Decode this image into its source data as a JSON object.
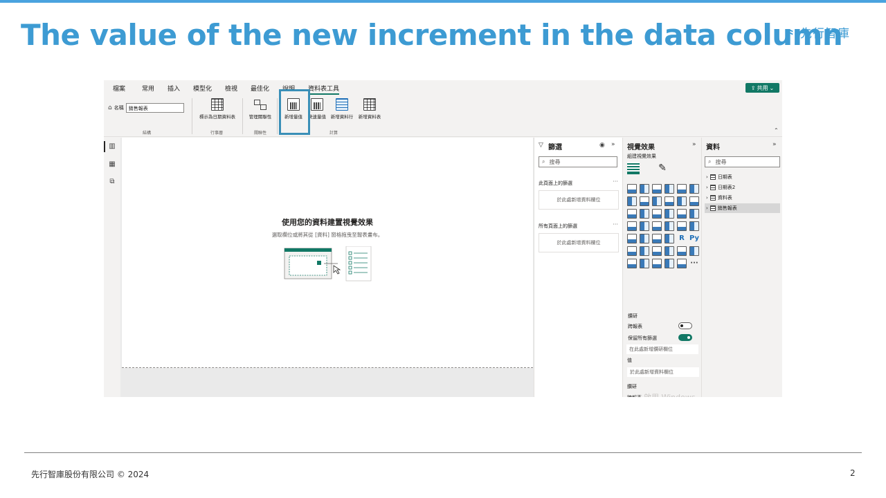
{
  "slide": {
    "title": "The value of the new increment in the data column",
    "logo_mark": "⺀",
    "logo_text": "先行智庫",
    "footer_left": "先行智庫股份有限公司 © 2024",
    "page_number": "2"
  },
  "menu": {
    "items": [
      "檔案",
      "常用",
      "插入",
      "模型化",
      "檢視",
      "最佳化",
      "說明",
      "資料表工具"
    ],
    "active": "資料表工具",
    "share_label": "共用"
  },
  "ribbon": {
    "name_label": "名稱",
    "name_value": "銷售報表",
    "groups": [
      "結構",
      "行事曆",
      "關聯性",
      "計算"
    ],
    "buttons": {
      "mark_date_table": "標示為日期資料表",
      "manage_relationships": "管理關聯性",
      "new_measure": "新增量值",
      "quick_measure": "快速量值",
      "new_column": "新增資料行",
      "new_table": "新增資料表"
    }
  },
  "canvas": {
    "title": "使用您的資料建置視覺效果",
    "subtitle": "選取欄位或將其從 [資料] 窗格拖曳至報表畫布。"
  },
  "filters": {
    "title": "篩選",
    "search_placeholder": "搜尋",
    "page_section": "此頁面上的篩選",
    "all_pages_section": "所有頁面上的篩選",
    "drop_hint": "於此處新增資料欄位"
  },
  "viz": {
    "title": "視覺效果",
    "subtitle": "組建視覺效果",
    "values_label": "值",
    "values_drop": "於此處新增資料欄位",
    "drillthrough_label": "鑽研",
    "cross_report_label": "跨報表",
    "keep_filters_label": "保留所有篩選",
    "drill_drop": "在此處新增鑽研欄位",
    "r_label": "R",
    "py_label": "Py",
    "more_label": "···",
    "watermark": "啟用 Windows"
  },
  "data_pane": {
    "title": "資料",
    "search_placeholder": "搜尋",
    "tables": [
      "日期表",
      "日期表2",
      "資料表",
      "銷售報表"
    ],
    "selected": "銷售報表"
  }
}
